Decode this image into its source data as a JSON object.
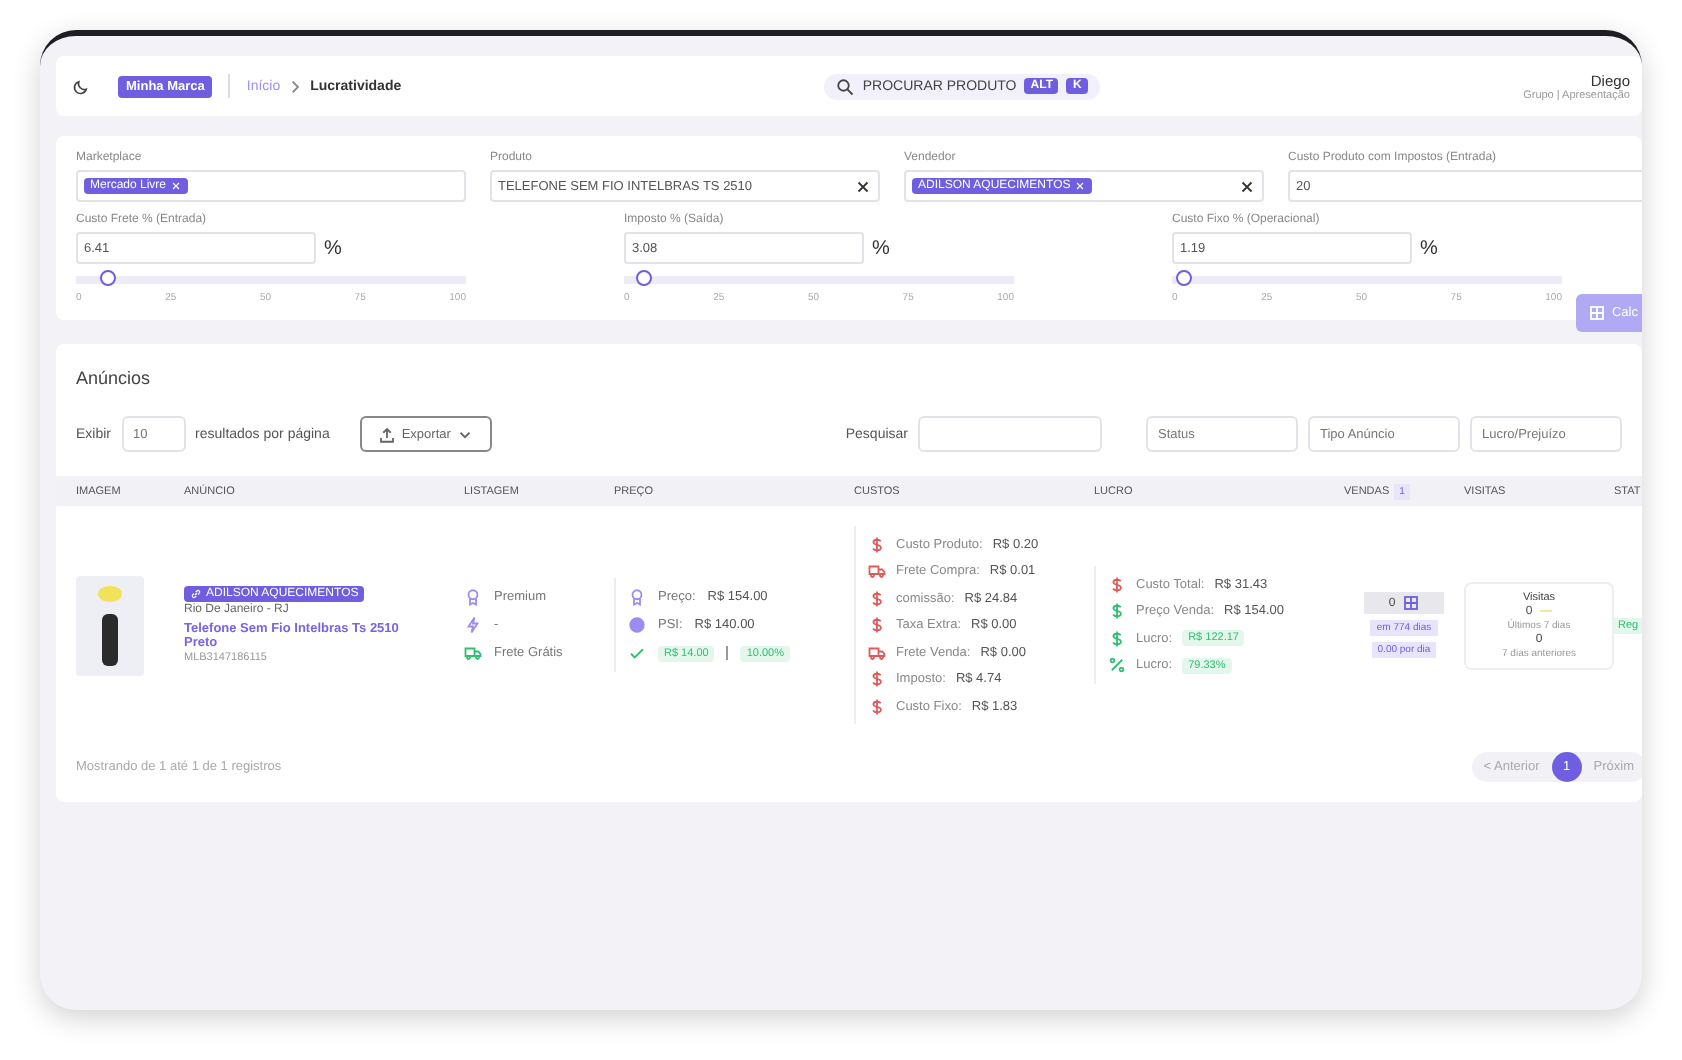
{
  "header": {
    "brand": "Minha Marca",
    "breadcrumb": [
      "Início",
      "Lucratividade"
    ],
    "search": {
      "placeholder": "PROCURAR PRODUTO",
      "keys": [
        "ALT",
        "K"
      ]
    },
    "user": {
      "name": "Diego",
      "role": "Grupo | Apresentação"
    }
  },
  "filters": {
    "fields": [
      {
        "kind": "tags",
        "label": "Marketplace",
        "tags": [
          "Mercado Livre"
        ]
      },
      {
        "kind": "select",
        "label": "Produto",
        "value": "TELEFONE SEM FIO INTELBRAS TS 2510"
      },
      {
        "kind": "tags",
        "label": "Vendedor",
        "tags": [
          "ADILSON AQUECIMENTOS"
        ]
      },
      {
        "kind": "text",
        "label": "Custo Produto com Impostos (Entrada)",
        "value": "20"
      }
    ],
    "sliders": [
      {
        "label": "Custo Frete % (Entrada)",
        "value": "6.41",
        "unit": "%",
        "level": 0.064,
        "ticks": [
          "0",
          "25",
          "50",
          "75",
          "100"
        ]
      },
      {
        "label": "Imposto % (Saída)",
        "value": "3.08",
        "unit": "%",
        "level": 0.031,
        "ticks": [
          "0",
          "25",
          "50",
          "75",
          "100"
        ]
      },
      {
        "label": "Custo Fixo % (Operacional)",
        "value": "1.19",
        "unit": "%",
        "level": 0.012,
        "ticks": [
          "0",
          "25",
          "50",
          "75",
          "100"
        ]
      }
    ],
    "button": "Calc"
  },
  "listings": {
    "title": "Anúncios",
    "show_label": "Exibir",
    "page_size": "10",
    "per_page_label": "resultados por página",
    "export": "Exportar",
    "search_label": "Pesquisar",
    "selects": [
      "Status",
      "Tipo Anúncio",
      "Lucro/Prejuízo"
    ],
    "columns": [
      "IMAGEM",
      "ANÚNCIO",
      "LISTAGEM",
      "PREÇO",
      "CUSTOS",
      "LUCRO",
      "VENDAS",
      "VISITAS",
      "STAT"
    ],
    "sales_badge": "1",
    "rows": [
      {
        "seller": "ADILSON AQUECIMENTOS",
        "location": "Rio De Janeiro - RJ",
        "title": "Telefone Sem Fio Intelbras Ts 2510 Preto",
        "code": "MLB3147186115",
        "listing": [
          {
            "kind": "medal",
            "text": "Premium"
          },
          {
            "kind": "bolt",
            "text": "-"
          },
          {
            "kind": "truck",
            "text": "Frete Grátis"
          }
        ],
        "price": {
          "price_label": "Preço:",
          "price": "R$ 154.00",
          "psi_label": "PSI:",
          "psi": "R$ 140.00",
          "diff": "R$ 14.00",
          "diff_pct": "10.00%"
        },
        "costs": [
          {
            "kind": "dollar",
            "label": "Custo Produto:",
            "value": "R$ 0.20"
          },
          {
            "kind": "truck",
            "label": "Frete Compra:",
            "value": "R$ 0.01"
          },
          {
            "kind": "dollar",
            "label": "comissão:",
            "value": "R$ 24.84"
          },
          {
            "kind": "dollar",
            "label": "Taxa Extra:",
            "value": "R$ 0.00"
          },
          {
            "kind": "truck",
            "label": "Frete Venda:",
            "value": "R$ 0.00"
          },
          {
            "kind": "dollar",
            "label": "Imposto:",
            "value": "R$ 4.74"
          },
          {
            "kind": "dollar",
            "label": "Custo Fixo:",
            "value": "R$ 1.83"
          }
        ],
        "profit": [
          {
            "kind": "dollar",
            "color": "#e05a5a",
            "label": "Custo Total:",
            "value": "R$ 31.43",
            "badge": false
          },
          {
            "kind": "dollar",
            "color": "#2fbf71",
            "label": "Preço Venda:",
            "value": "R$ 154.00",
            "badge": false
          },
          {
            "kind": "dollar",
            "color": "#2fbf71",
            "label": "Lucro:",
            "value": "R$ 122.17",
            "badge": true
          },
          {
            "kind": "percent",
            "color": "#2fbf71",
            "label": "Lucro:",
            "value": "79.33%",
            "badge": true
          }
        ],
        "sales": {
          "count": "0",
          "days": "em 774 dias",
          "per_day": "0.00 por dia"
        },
        "visits": {
          "title": "Visitas",
          "count": "0",
          "trend": "—",
          "recent_label": "Últimos 7 dias",
          "previous": "0",
          "previous_label": "7 dias anteriores"
        },
        "status": "Reg"
      }
    ],
    "footer": "Mostrando de 1 até 1 de 1 registros",
    "pagination": {
      "prev": "< Anterior",
      "pages": [
        {
          "label": "1",
          "selected": true
        }
      ],
      "next": "Próxim"
    }
  }
}
